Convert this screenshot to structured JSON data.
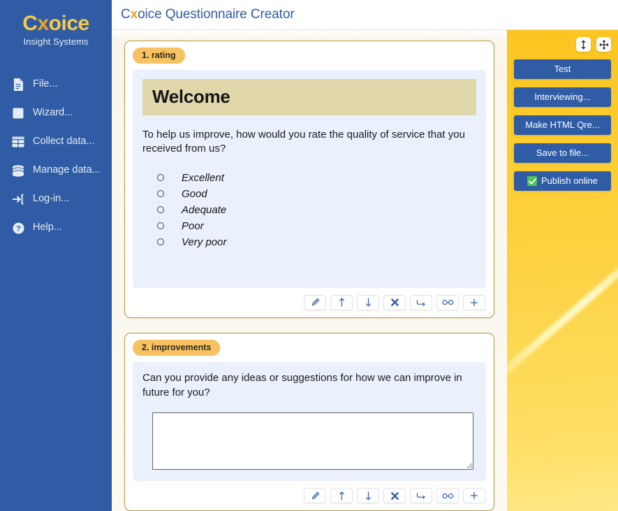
{
  "brand": {
    "logo_prefix": "C",
    "logo_x": "x",
    "logo_suffix": "oice",
    "logo_tagline": "Insight Systems",
    "accent_yellow": "#f7c945",
    "accent_orange": "#f0a31e",
    "sidebar_blue": "#2f5ca5",
    "panel_yellow": "#fcc41f",
    "badge_orange": "#f8c263",
    "banner_khaki": "#e0d8ab",
    "question_bg_blue": "#eaf1fd",
    "check_green": "#4fc155"
  },
  "header": {
    "title_prefix": "C",
    "title_x": "x",
    "title_suffix": "oice Questionnaire Creator"
  },
  "sidebar": {
    "items": [
      {
        "label": "File...",
        "icon": "document-icon"
      },
      {
        "label": "Wizard...",
        "icon": "window-icon"
      },
      {
        "label": "Collect data...",
        "icon": "table-grid-icon"
      },
      {
        "label": "Manage data...",
        "icon": "database-icon"
      },
      {
        "label": "Log-in...",
        "icon": "login-arrow-icon"
      },
      {
        "label": "Help...",
        "icon": "question-circle-icon"
      }
    ]
  },
  "questions": [
    {
      "badge": "1. rating",
      "banner": "Welcome",
      "text": "To help us improve, how would you rate the quality of service that you received from us?",
      "type": "radio",
      "options": [
        "Excellent",
        "Good",
        "Adequate",
        "Poor",
        "Very poor"
      ]
    },
    {
      "badge": "2. improvements",
      "text": "Can you provide any ideas or suggestions for how we can improve in future for you?",
      "type": "textarea",
      "textarea_value": "",
      "textarea_placeholder": ""
    }
  ],
  "question_toolbar": [
    {
      "icon": "pencil-edit-icon",
      "title": "Edit"
    },
    {
      "icon": "arrow-up-icon",
      "title": "Move up"
    },
    {
      "icon": "arrow-down-icon",
      "title": "Move down"
    },
    {
      "icon": "delete-x-icon",
      "title": "Delete"
    },
    {
      "icon": "arrow-hook-right-icon",
      "title": "Routing"
    },
    {
      "icon": "chain-link-icon",
      "title": "Link"
    },
    {
      "icon": "plus-icon",
      "title": "Add"
    }
  ],
  "right_panel": {
    "icons": [
      {
        "icon": "resize-vertical-icon",
        "title": "Resize"
      },
      {
        "icon": "move-arrows-icon",
        "title": "Move"
      }
    ],
    "buttons": [
      {
        "label": "Test",
        "checkbox": false
      },
      {
        "label": "Interviewing...",
        "checkbox": false
      },
      {
        "label": "Make HTML Qre...",
        "checkbox": false
      },
      {
        "label": "Save to file...",
        "checkbox": false
      },
      {
        "label": "Publish online",
        "checkbox": true,
        "checked": true
      }
    ]
  }
}
